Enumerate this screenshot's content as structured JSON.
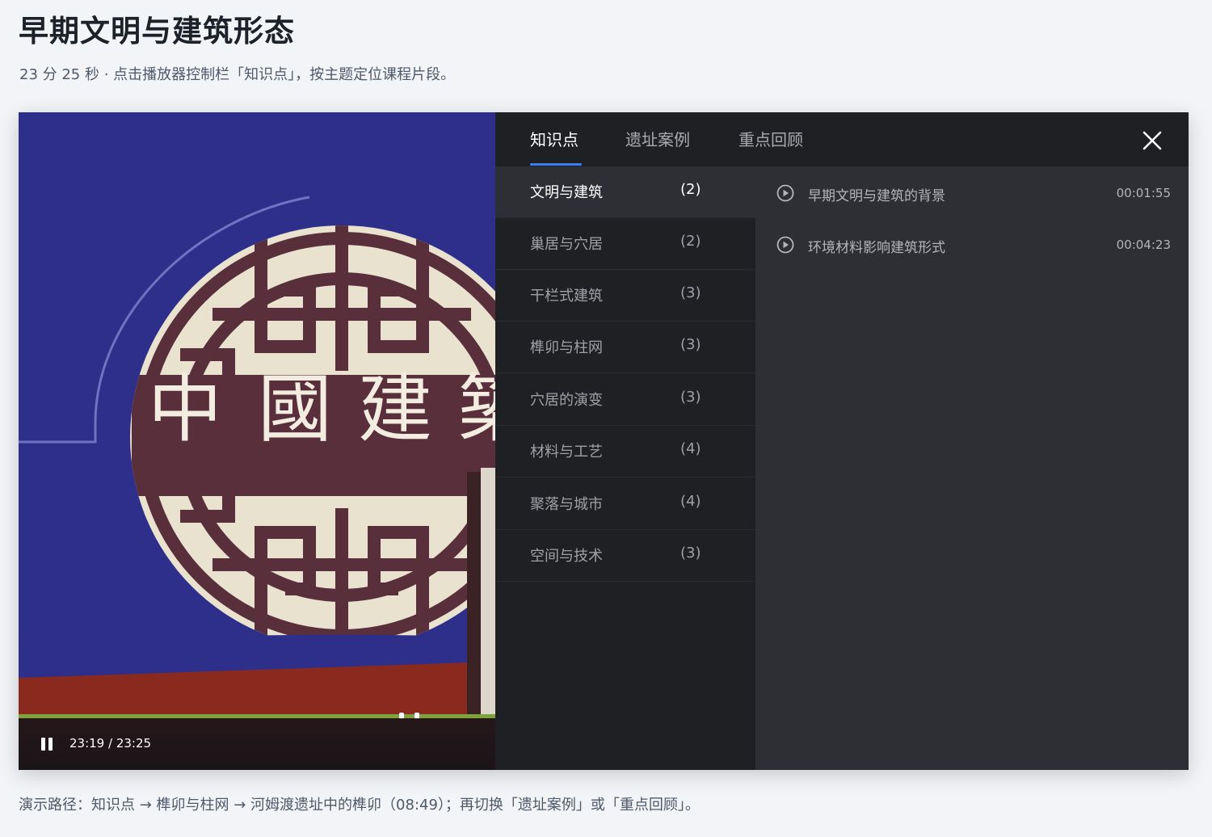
{
  "page": {
    "title": "早期文明与建筑形态",
    "subtitle": "23 分 25 秒 · 点击播放器控制栏「知识点」，按主题定位课程片段。",
    "footer_note": "演示路径：知识点 → 榫卯与柱网 → 河姆渡遗址中的榫卯（08:49）；再切换「遗址案例」或「重点回顾」。"
  },
  "video": {
    "time_readout": "23:19 / 23:25",
    "progress": 0.996,
    "banner_characters": [
      "中",
      "國",
      "建",
      "築"
    ],
    "colors": {
      "backdrop": "#2e2f8a",
      "medallion": "#e9e2cf",
      "lattice": "#5a2f3c",
      "floor": "#8a2a1f",
      "progress": "#7ea33a"
    },
    "icons": {
      "pause": "pause-icon"
    }
  },
  "panel": {
    "tabs": [
      {
        "label": "知识点",
        "active": true
      },
      {
        "label": "遗址案例",
        "active": false
      },
      {
        "label": "重点回顾",
        "active": false
      }
    ],
    "close_icon": "close-icon",
    "accent_color": "#3b7cf5",
    "topics": [
      {
        "label": "文明与建筑",
        "count": "(2)",
        "active": true
      },
      {
        "label": "巢居与穴居",
        "count": "(2)",
        "active": false
      },
      {
        "label": "干栏式建筑",
        "count": "(3)",
        "active": false
      },
      {
        "label": "榫卯与柱网",
        "count": "(3)",
        "active": false
      },
      {
        "label": "穴居的演变",
        "count": "(3)",
        "active": false
      },
      {
        "label": "材料与工艺",
        "count": "(4)",
        "active": false
      },
      {
        "label": "聚落与城市",
        "count": "(4)",
        "active": false
      },
      {
        "label": "空间与技术",
        "count": "(3)",
        "active": false
      }
    ],
    "points": [
      {
        "label": "早期文明与建筑的背景",
        "time": "00:01:55"
      },
      {
        "label": "环境材料影响建筑形式",
        "time": "00:04:23"
      }
    ]
  }
}
